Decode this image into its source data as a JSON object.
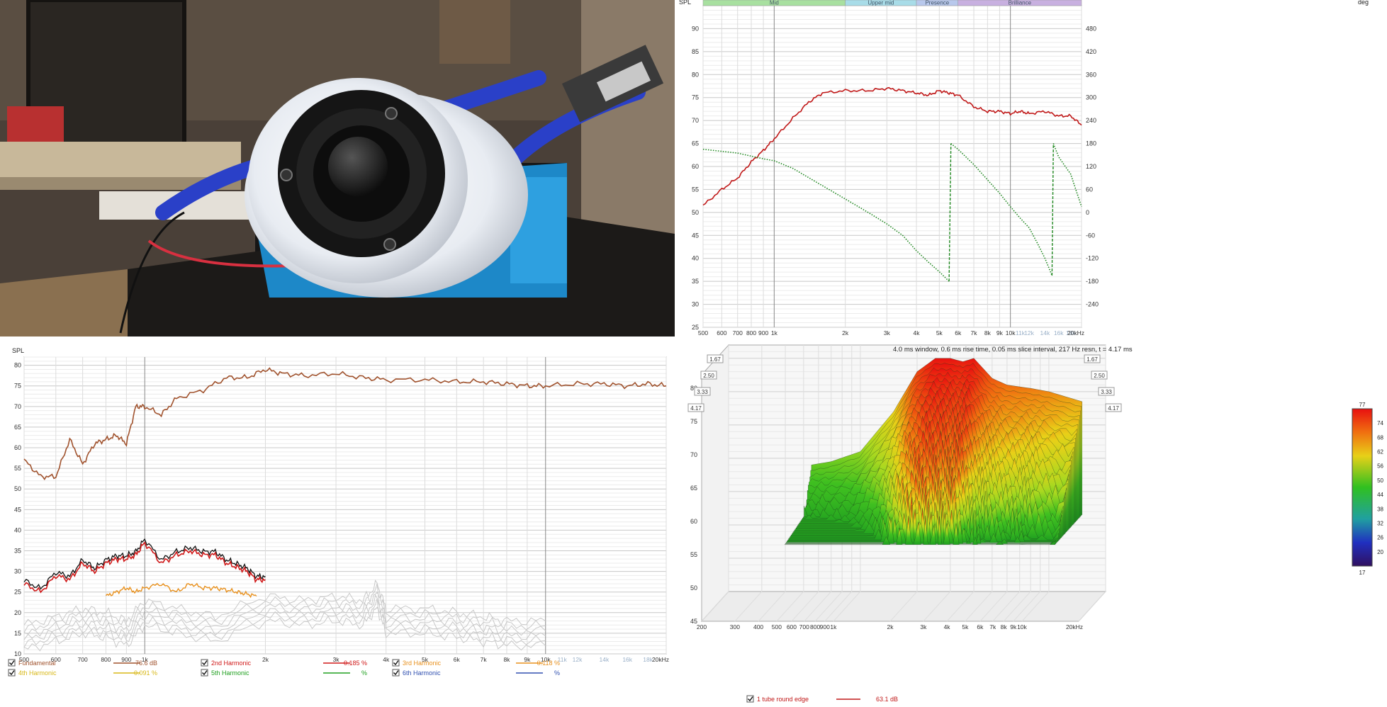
{
  "fr_panel": {
    "spl_label": "SPL",
    "deg_label": "deg",
    "bands": [
      "Mid",
      "Upper mid",
      "Presence",
      "Brilliance"
    ],
    "band_colors": [
      "#a8e0a0",
      "#a8dce8",
      "#b8c8ec",
      "#c8b0e0"
    ],
    "y_ticks_left": [
      "90",
      "85",
      "80",
      "75",
      "70",
      "65",
      "60",
      "55",
      "50",
      "45",
      "40",
      "35",
      "30",
      "25"
    ],
    "y_ticks_right": [
      "480",
      "420",
      "360",
      "300",
      "240",
      "180",
      "120",
      "60",
      "0",
      "-60",
      "-120",
      "-180",
      "-240"
    ],
    "x_ticks": [
      "500",
      "600",
      "700",
      "800",
      "900",
      "1k",
      "2k",
      "3k",
      "4k",
      "5k",
      "6k",
      "7k",
      "8k",
      "9k",
      "10k",
      "11k",
      "12k",
      "14k",
      "16k",
      "18k",
      "20kHz"
    ]
  },
  "dist_panel": {
    "spl_label": "SPL",
    "y_ticks": [
      "80",
      "75",
      "70",
      "65",
      "60",
      "55",
      "50",
      "45",
      "40",
      "35",
      "30",
      "25",
      "20",
      "15",
      "10"
    ],
    "x_ticks": [
      "500",
      "600",
      "700",
      "800",
      "900",
      "1k",
      "2k",
      "3k",
      "4k",
      "5k",
      "6k",
      "7k",
      "8k",
      "9k",
      "10k",
      "11k",
      "12k",
      "14k",
      "16k",
      "18k",
      "20kHz"
    ],
    "legend": [
      {
        "label": "Fundamental",
        "value": "76.6 dB",
        "color": "#a0522d"
      },
      {
        "label": "2nd Harmonic",
        "value": "0.185 %",
        "color": "#d01818"
      },
      {
        "label": "3rd Harmonic",
        "value": "0.118 %",
        "color": "#e8901c"
      },
      {
        "label": "4th Harmonic",
        "value": "0.091 %",
        "color": "#d8b818"
      },
      {
        "label": "5th Harmonic",
        "value": "%",
        "color": "#20a020"
      },
      {
        "label": "6th Harmonic",
        "value": "%",
        "color": "#3050b0"
      }
    ]
  },
  "csd_panel": {
    "info": "4.0 ms window, 0.6 ms rise time, 0.05 ms slice interval, 217 Hz resn, t = 4.17 ms",
    "y_ticks": [
      "80",
      "75",
      "70",
      "65",
      "60",
      "55",
      "50",
      "45"
    ],
    "x_ticks": [
      "200",
      "300",
      "400",
      "500",
      "600",
      "700",
      "800",
      "900",
      "1k",
      "2k",
      "3k",
      "4k",
      "5k",
      "6k",
      "7k",
      "8k",
      "9k",
      "10k",
      "20kHz"
    ],
    "time_ticks": [
      "1.67",
      "2.50",
      "3.33",
      "4.17"
    ],
    "scale_ticks": [
      "77",
      "74",
      "68",
      "62",
      "56",
      "50",
      "44",
      "38",
      "32",
      "26",
      "20",
      "17"
    ],
    "legend_label": "1 tube round edge",
    "legend_value": "63.1 dB"
  },
  "chart_data": [
    {
      "type": "line",
      "title": "",
      "xlabel": "",
      "ylabel": "SPL",
      "xscale": "log",
      "xlim": [
        500,
        20000
      ],
      "ylim": [
        25,
        95
      ],
      "y2label": "deg",
      "y2lim": [
        -300,
        540
      ],
      "series": [
        {
          "color": "#c01818",
          "axis": "left",
          "x": [
            500,
            600,
            700,
            800,
            900,
            1000,
            1200,
            1400,
            1600,
            2000,
            2500,
            3000,
            3500,
            4000,
            4500,
            5000,
            5500,
            6000,
            7000,
            8000,
            9000,
            10000,
            11000,
            12000,
            14000,
            16000,
            18000,
            20000
          ],
          "y": [
            51.5,
            55,
            57.5,
            61,
            63.5,
            66,
            70.5,
            74,
            76,
            76.5,
            76.5,
            77,
            76.5,
            76,
            75.5,
            76.5,
            76,
            75.5,
            73,
            72,
            72,
            71.5,
            72,
            71.5,
            72,
            71,
            71,
            69
          ]
        },
        {
          "color": "#208820",
          "axis": "right",
          "style": "dotted",
          "x": [
            500,
            700,
            900,
            1000,
            1200,
            1500,
            2000,
            2500,
            3000,
            3500,
            4000,
            4500,
            5000,
            5500,
            5600,
            6000,
            7000,
            8000,
            9000,
            10000,
            11000,
            12000,
            13000,
            14000,
            15000,
            15200,
            16000,
            18000,
            20000
          ],
          "y": [
            165,
            155,
            140,
            135,
            115,
            80,
            35,
            0,
            -30,
            -60,
            -100,
            -130,
            -155,
            -180,
            180,
            165,
            125,
            85,
            50,
            15,
            -15,
            -40,
            -80,
            -120,
            -165,
            180,
            145,
            100,
            15
          ]
        }
      ]
    },
    {
      "type": "line",
      "title": "",
      "xlabel": "",
      "ylabel": "SPL",
      "xscale": "log",
      "xlim": [
        500,
        20000
      ],
      "ylim": [
        10,
        82
      ],
      "series": [
        {
          "name": "Fundamental",
          "color": "#a0522d",
          "x": [
            500,
            550,
            600,
            650,
            700,
            750,
            800,
            850,
            900,
            950,
            1000,
            1100,
            1200,
            1400,
            1600,
            1800,
            2000,
            2200,
            2500,
            3000,
            3500,
            4000,
            5000,
            6000,
            7000,
            8000,
            9000,
            10000,
            12000,
            14000,
            16000,
            18000,
            20000
          ],
          "y": [
            57,
            53,
            53,
            62,
            56,
            61,
            62,
            63,
            61,
            70,
            70,
            68,
            72,
            74,
            77,
            77,
            79,
            78,
            77.5,
            78,
            77,
            76.5,
            76.5,
            76,
            76,
            75.5,
            75,
            75,
            75.5,
            75.5,
            75,
            75.5,
            75
          ]
        },
        {
          "name": "2nd Harmonic",
          "color": "#d01818",
          "x": [
            500,
            550,
            600,
            650,
            700,
            750,
            800,
            850,
            900,
            950,
            1000,
            1100,
            1200,
            1300,
            1400,
            1500,
            1600,
            1700,
            1800,
            1900,
            2000
          ],
          "y": [
            27,
            25,
            29,
            28,
            32,
            30,
            32,
            33,
            33,
            34,
            37,
            32,
            34,
            35,
            34,
            34,
            32,
            31,
            30,
            28,
            28
          ]
        },
        {
          "name": "3rd Harmonic",
          "color": "#e8901c",
          "x": [
            800,
            850,
            900,
            950,
            1000,
            1100,
            1200,
            1300,
            1400,
            1500,
            1600,
            1700,
            1800,
            1900
          ],
          "y": [
            24,
            25,
            26,
            25,
            26,
            27,
            25,
            27,
            26,
            26,
            25.5,
            25,
            24.5,
            24
          ]
        },
        {
          "name": "4th Harmonic",
          "color": "#c8c8c8",
          "x": [
            500,
            600,
            700,
            800,
            900,
            1000,
            1200,
            1500,
            2000,
            2500,
            3000,
            3500,
            3800,
            4000,
            5000,
            6000,
            7000,
            8000,
            10000
          ],
          "y": [
            18,
            20,
            22,
            21,
            19,
            24,
            22,
            20,
            25,
            24,
            25,
            24,
            28,
            22,
            22,
            21,
            20,
            19,
            19
          ]
        }
      ]
    },
    {
      "type": "heatmap",
      "title": "",
      "xlabel": "",
      "ylabel": "",
      "xscale": "log",
      "xlim": [
        200,
        20000
      ],
      "ylim": [
        45,
        82
      ],
      "time_ms": [
        0,
        1.67,
        2.5,
        3.33,
        4.17
      ],
      "colorscale_db": [
        17,
        77
      ],
      "x": [
        550,
        700,
        1000,
        1500,
        2000,
        2500,
        3000,
        3500,
        4000,
        5000,
        6000,
        8000,
        10000,
        15000
      ],
      "y": [
        64,
        64.5,
        66,
        72,
        78,
        80,
        80,
        79.5,
        80,
        77,
        76,
        75.5,
        75,
        73.5
      ]
    }
  ]
}
